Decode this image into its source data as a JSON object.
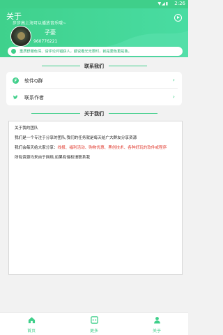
{
  "statusbar": {
    "time": "2:26",
    "icons": "▼◢▮"
  },
  "header": {
    "title": "关于",
    "subtitle": "步步高上海可以播放音乐哦~",
    "user_name": "子豪",
    "qq": "960776221"
  },
  "notice": "重质舒服色深、请评论问错获人，都说看光无限时，就是更色更是鲁。",
  "contact_section": {
    "title": "联系我们",
    "items": [
      {
        "label": "软件Q群",
        "icon": "qq-group-icon"
      },
      {
        "label": "联系作者",
        "icon": "twitter-bird-icon"
      }
    ]
  },
  "about_section": {
    "title": "关于我们",
    "p1": "关于我的团队",
    "p2": "我们是一个专注于分享的团队,我们的任务就是每天给广大群友分享资源",
    "p3_prefix": "我们会每天给大家分享：",
    "p3_red": "线报、福利活动、购物优惠、黑创技术、各种好玩的软件或程序",
    "p4": "所有资源均来自于网络,如果有侵权请联系我"
  },
  "tabs": [
    {
      "label": "首页",
      "icon": "home-icon"
    },
    {
      "label": "更多",
      "icon": "more-icon"
    },
    {
      "label": "关于",
      "icon": "user-icon"
    }
  ],
  "colors": {
    "accent": "#3fcf8a",
    "red": "#e03a2e",
    "background": "#f2f2f2"
  }
}
